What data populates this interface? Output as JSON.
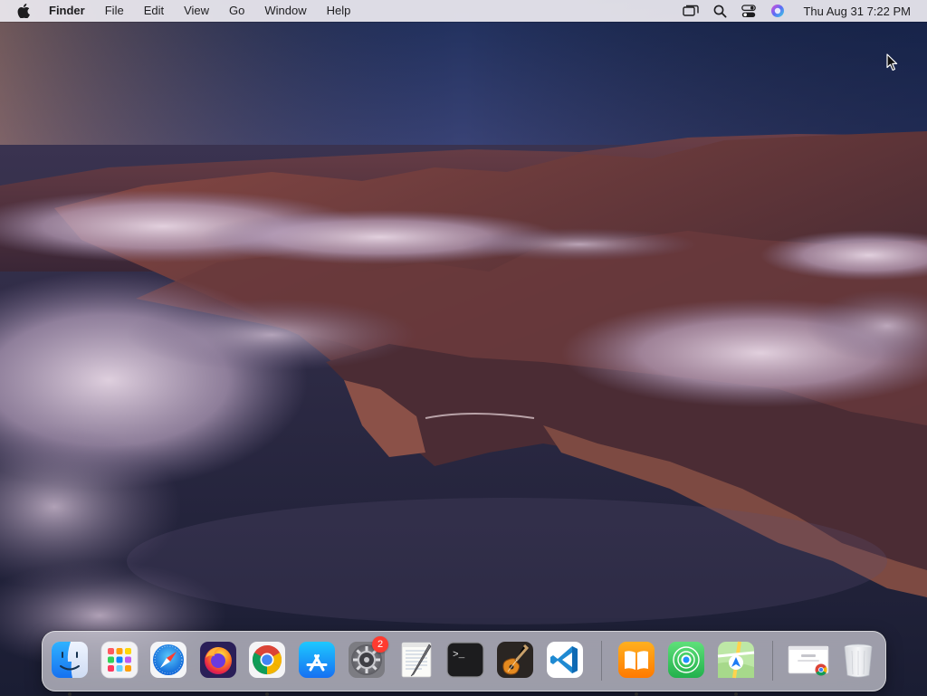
{
  "menubar": {
    "apple_icon": "apple-logo-icon",
    "app_name": "Finder",
    "menus": [
      "File",
      "Edit",
      "View",
      "Go",
      "Window",
      "Help"
    ],
    "status_icons": [
      "screen-mirroring-icon",
      "spotlight-search-icon",
      "control-center-icon",
      "siri-icon"
    ],
    "clock": "Thu Aug 31  7:22 PM"
  },
  "dock": {
    "apps": [
      {
        "name": "Finder",
        "icon": "finder-icon",
        "running": true
      },
      {
        "name": "Launchpad",
        "icon": "launchpad-icon",
        "running": false
      },
      {
        "name": "Safari",
        "icon": "safari-icon",
        "running": false
      },
      {
        "name": "Firefox",
        "icon": "firefox-icon",
        "running": false
      },
      {
        "name": "Google Chrome",
        "icon": "chrome-icon",
        "running": true
      },
      {
        "name": "App Store",
        "icon": "app-store-icon",
        "running": false
      },
      {
        "name": "System Preferences",
        "icon": "system-preferences-icon",
        "running": false,
        "badge": "2"
      },
      {
        "name": "TextEdit",
        "icon": "textedit-icon",
        "running": false
      },
      {
        "name": "Terminal",
        "icon": "terminal-icon",
        "running": false
      },
      {
        "name": "GarageBand",
        "icon": "garageband-icon",
        "running": false
      },
      {
        "name": "Visual Studio Code",
        "icon": "vscode-icon",
        "running": false
      },
      {
        "name": "Books",
        "icon": "books-icon",
        "running": true
      },
      {
        "name": "Find My",
        "icon": "find-my-icon",
        "running": false
      },
      {
        "name": "Maps",
        "icon": "maps-icon",
        "running": true
      },
      {
        "name": "Chrome Window",
        "icon": "chrome-window-thumbnail-icon",
        "running": false
      },
      {
        "name": "Trash",
        "icon": "trash-icon",
        "running": false
      }
    ],
    "terminal_prompt": ">_",
    "colors": {
      "badge": "#ff3b30",
      "finder": "#1e8ef5",
      "vscode": "#1f8ad2",
      "books": "#ff8a00"
    }
  },
  "wallpaper": {
    "name": "macOS Big Sur coastline",
    "icon": "desktop-wallpaper"
  }
}
